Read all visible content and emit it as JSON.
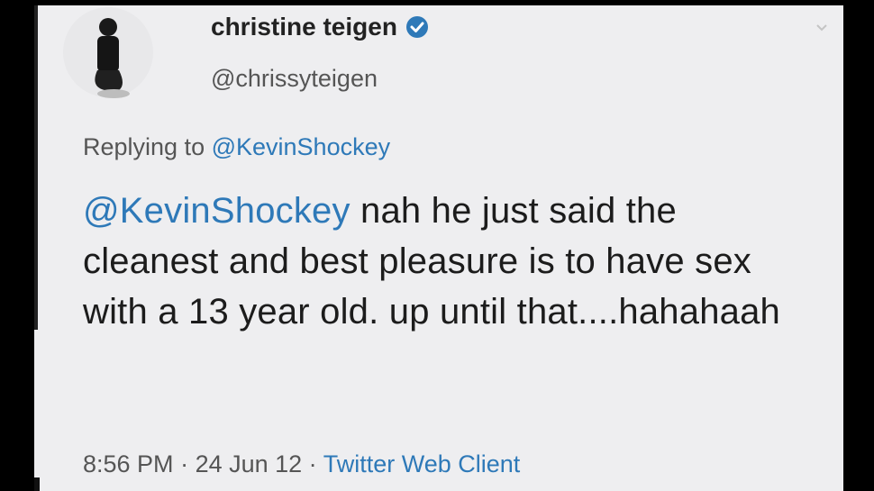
{
  "author": {
    "display_name": "christine teigen",
    "handle": "@chrissyteigen",
    "avatar_icon": "avatar-photo",
    "verified_icon": "verified-badge-icon"
  },
  "reply": {
    "prefix": "Replying to ",
    "to": "@KevinShockey"
  },
  "tweet": {
    "mention": "@KevinShockey",
    "text": " nah he just said the cleanest and best pleasure is to have sex with a 13 year old. up until that....hahahaah"
  },
  "meta": {
    "time": "8:56 PM",
    "sep1": " · ",
    "date": "24 Jun 12",
    "sep2": " · ",
    "client": "Twitter Web Client"
  },
  "colors": {
    "link": "#2e79b8",
    "background": "#eeeef0",
    "text": "#1c1c1c"
  }
}
